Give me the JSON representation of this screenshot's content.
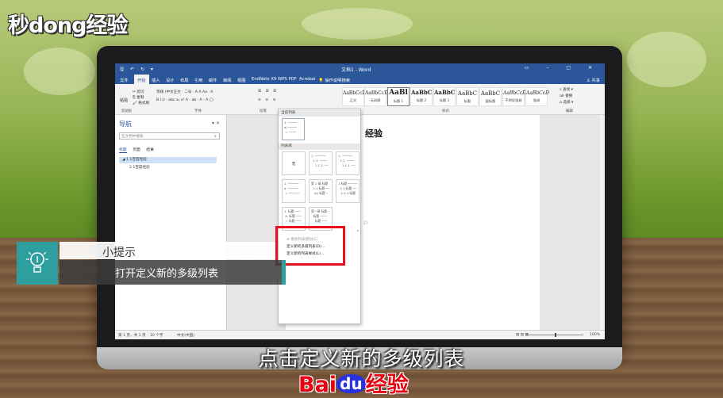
{
  "watermark_logo": "秒dong经验",
  "word": {
    "quick_access": "🖫 ↶ ↻ ▾",
    "title": "文档1 - Word",
    "window_controls": "▭ – ▢ ✕",
    "tabs": [
      "文件",
      "开始",
      "插入",
      "设计",
      "布局",
      "引用",
      "邮件",
      "审阅",
      "视图",
      "EndNote X9",
      "WPS PDF",
      "Acrobat"
    ],
    "active_tab": "开始",
    "tell_me": "💡 操作说明搜索",
    "share": "♙ 共享",
    "ribbon": {
      "clipboard_label": "剪贴板",
      "paste": "粘贴",
      "cut": "✂ 剪切",
      "copy": "⎘ 复制",
      "format_painter": "🖌 格式刷",
      "font_row1": "等线 (中文正文 · 二号 · A A Aa · A",
      "font_row2": "B I U · abc x₂ x² A · ab · A · A ◯",
      "font_label": "字体",
      "para_label": "段落",
      "all_label": "全部 ▾",
      "styles": [
        {
          "sample": "AaBbCcDc",
          "name": "正文"
        },
        {
          "sample": "AaBbCcDc",
          "name": "无间隔"
        },
        {
          "sample": "AaBl",
          "name": "标题 1"
        },
        {
          "sample": "AaBbC",
          "name": "标题 2"
        },
        {
          "sample": "AaBbC",
          "name": "标题 3"
        },
        {
          "sample": "AaBbC",
          "name": "标题"
        },
        {
          "sample": "AaBbC",
          "name": "副标题"
        },
        {
          "sample": "AaBbCcD",
          "name": "不明显强调"
        },
        {
          "sample": "AaBbCcD",
          "name": "强调"
        }
      ],
      "styles_label": "样式",
      "find": "⌕ 查找 ▾",
      "replace": "ab 替换",
      "select": "⌂ 选择 ▾",
      "editing_label": "编辑"
    },
    "nav": {
      "title": "导航",
      "search_placeholder": "在文档中搜索",
      "tabs": [
        "标题",
        "页面",
        "结果"
      ],
      "item1": "◢ 1.1百度经验",
      "item2": "2.1百度经验"
    },
    "doc_visible_text": "经验",
    "dropdown": {
      "current_list_header": "当前列表",
      "current_list": "1. ─────\na) ─────\n  i. ────",
      "library_header": "列表库",
      "none_label": "无",
      "lib_items": [
        "1. ──────\n  1.1. ────\n    1.1.1. ──",
        "1. ──────\n  1.1. ────\n    1.1.1. ──",
        "1. ──────\na. ──────\n  i. ──────",
        "第 1 章 标题\n  1.1 标题 ──\n   (a) 标题 ─",
        "1 标题 ─────\n  1.1 标题 ──\n   1.1.1 标题",
        "1. 标题 ───\n A. 标题 ───\n  I. 标题 ───",
        "第一章 标题 ─\n  标题 ────\n    标题 ───"
      ],
      "change_level": "≣ 更改列表级别(C)",
      "define_new_list": "定义新的多级列表(D)...",
      "define_new_style": "定义新的列表样式(L)..."
    },
    "status": {
      "page": "第 1 页，共 1 页",
      "words": "10 个字",
      "lang": "中文(中国)",
      "zoom": "100%"
    }
  },
  "tip": {
    "label": "小提示",
    "text": "打开定义新的多级列表"
  },
  "subtitle": "点击定义新的多级列表",
  "brand": {
    "bai": "Bai",
    "du": "du",
    "jingyan": "经验"
  }
}
